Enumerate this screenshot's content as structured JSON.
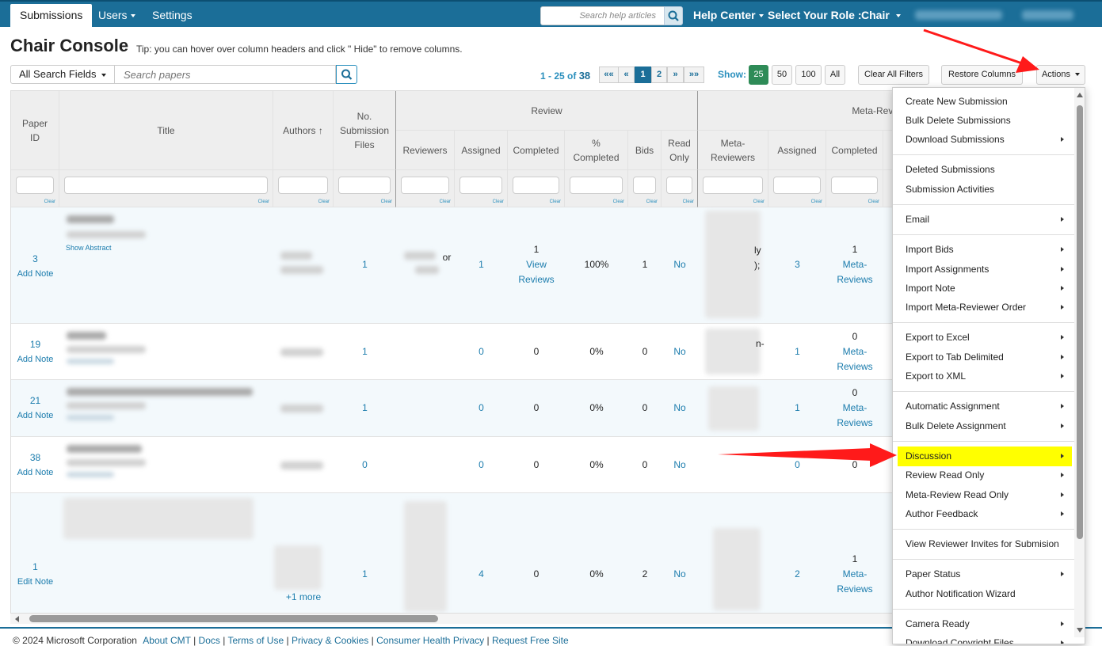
{
  "nav": {
    "tabs": [
      "Submissions",
      "Users",
      "Settings"
    ],
    "help_placeholder": "Search help articles",
    "help_center": "Help Center",
    "role_label": "Select Your Role :",
    "role_value": "Chair"
  },
  "page": {
    "title": "Chair Console",
    "tip": "Tip: you can hover over column headers and click \" Hide\" to remove columns."
  },
  "toolbar": {
    "search_fields": "All Search Fields",
    "search_placeholder": "Search papers",
    "page_range": "1 - 25 of ",
    "total": "38",
    "pager": [
      "««",
      "«",
      "1",
      "2",
      "»",
      "»»"
    ],
    "show_label": "Show:",
    "show_options": [
      "25",
      "50",
      "100",
      "All"
    ],
    "clear_filters": "Clear All Filters",
    "restore_columns": "Restore Columns",
    "actions": "Actions"
  },
  "table": {
    "group_review": "Review",
    "group_meta": "Meta-Revi",
    "headers": {
      "paper_id": "Paper ID",
      "title": "Title",
      "authors": "Authors ↑",
      "files": "No. Submission Files",
      "reviewers": "Reviewers",
      "assigned": "Assigned",
      "completed": "Completed",
      "pct_completed": "% Completed",
      "bids": "Bids",
      "read_only": "Read Only",
      "meta_reviewers": "Meta-Reviewers",
      "meta_assigned": "Assigned",
      "meta_completed": "Completed"
    },
    "clear_label": "Clear",
    "rows": [
      {
        "id": "3",
        "note": "Add Note",
        "abstract": "Show Abstract",
        "files": "1",
        "reviewers": "or",
        "assigned": "1",
        "completed": "1",
        "completed_link": "View Reviews",
        "pct": "100%",
        "bids": "1",
        "read_only": "No",
        "meta_text": "ly\n);",
        "meta_assigned": "3",
        "meta_completed": "1",
        "meta_link": "Meta-Reviews"
      },
      {
        "id": "19",
        "note": "Add Note",
        "files": "1",
        "assigned": "0",
        "completed": "0",
        "pct": "0%",
        "bids": "0",
        "read_only": "No",
        "meta_text": "n-",
        "meta_assigned": "1",
        "meta_completed": "0",
        "meta_link": "Meta-Reviews"
      },
      {
        "id": "21",
        "note": "Add Note",
        "files": "1",
        "assigned": "0",
        "completed": "0",
        "pct": "0%",
        "bids": "0",
        "read_only": "No",
        "meta_assigned": "1",
        "meta_completed": "0",
        "meta_link": "Meta-Reviews"
      },
      {
        "id": "38",
        "note": "Add Note",
        "files": "0",
        "assigned": "0",
        "completed": "0",
        "pct": "0%",
        "bids": "0",
        "read_only": "No",
        "meta_assigned": "0",
        "meta_completed": "0"
      },
      {
        "id": "1",
        "note": "Edit Note",
        "more": "+1 more",
        "files": "1",
        "assigned": "4",
        "completed": "0",
        "pct": "0%",
        "bids": "2",
        "read_only": "No",
        "meta_assigned": "2",
        "meta_completed": "1",
        "meta_link": "Meta-Reviews"
      }
    ]
  },
  "actions_menu": {
    "items": [
      {
        "label": "Create New Submission",
        "sub": false
      },
      {
        "label": "Bulk Delete Submissions",
        "sub": false
      },
      {
        "label": "Download Submissions",
        "sub": true
      },
      {
        "label": "Deleted Submissions",
        "sub": false
      },
      {
        "label": "Submission Activities",
        "sub": false
      },
      {
        "label": "Email",
        "sub": true
      },
      {
        "label": "Import Bids",
        "sub": true
      },
      {
        "label": "Import Assignments",
        "sub": true
      },
      {
        "label": "Import Note",
        "sub": true
      },
      {
        "label": "Import Meta-Reviewer Order",
        "sub": true
      },
      {
        "label": "Export to Excel",
        "sub": true
      },
      {
        "label": "Export to Tab Delimited",
        "sub": true
      },
      {
        "label": "Export to XML",
        "sub": true
      },
      {
        "label": "Automatic Assignment",
        "sub": true
      },
      {
        "label": "Bulk Delete Assignment",
        "sub": true
      },
      {
        "label": "Discussion",
        "sub": true,
        "highlight": true
      },
      {
        "label": "Review Read Only",
        "sub": true
      },
      {
        "label": "Meta-Review Read Only",
        "sub": true
      },
      {
        "label": "Author Feedback",
        "sub": true
      },
      {
        "label": "View Reviewer Invites for Submision",
        "sub": false
      },
      {
        "label": "Paper Status",
        "sub": true
      },
      {
        "label": "Author Notification Wizard",
        "sub": false
      },
      {
        "label": "Camera Ready",
        "sub": true
      },
      {
        "label": "Download Copyright Files",
        "sub": true
      }
    ],
    "highlight_color": "#ffff00"
  },
  "footer": {
    "copyright": "© 2024 Microsoft Corporation",
    "links": [
      "About CMT",
      "Docs",
      "Terms of Use",
      "Privacy & Cookies",
      "Consumer Health Privacy",
      "Request Free Site"
    ]
  },
  "colors": {
    "nav": "#1b6e98",
    "link": "#1b7cad",
    "show_active": "#2e8b57",
    "annotation_arrow": "#ff0000"
  }
}
